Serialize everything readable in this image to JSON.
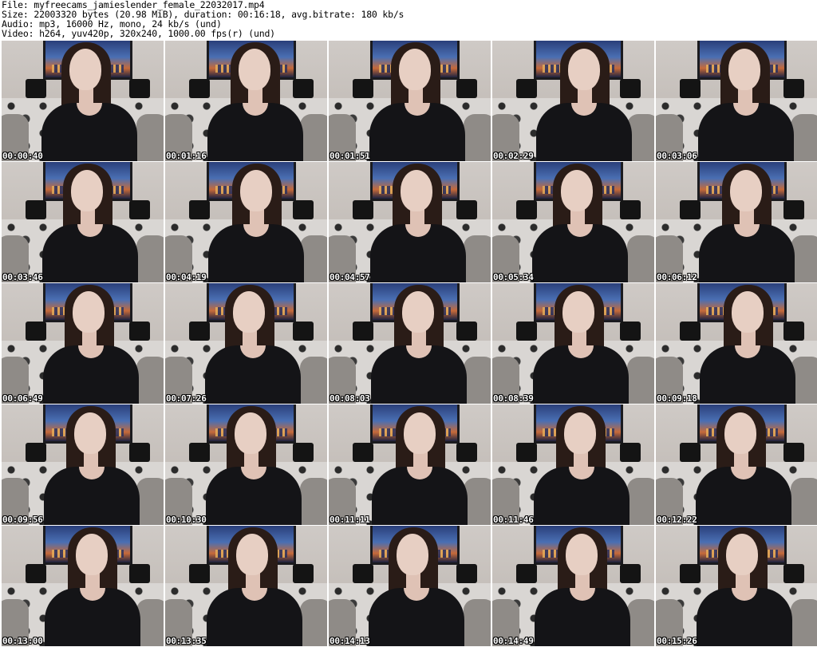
{
  "header": {
    "file_line": "File: myfreecams_jamieslender_female_22032017.mp4",
    "size_line": "Size: 22003320 bytes (20.98 MiB), duration: 00:16:18, avg.bitrate: 180 kb/s",
    "audio_line": "Audio: mp3, 16000 Hz, mono, 24 kb/s (und)",
    "video_line": "Video: h264, yuv420p, 320x240, 1000.00 fps(r) (und)"
  },
  "timestamps": [
    "00:00:40",
    "00:01:16",
    "00:01:51",
    "00:02:29",
    "00:03:06",
    "00:03:46",
    "00:04:19",
    "00:04:57",
    "00:05:34",
    "00:06:12",
    "00:06:49",
    "00:07:26",
    "00:08:03",
    "00:08:39",
    "00:09:18",
    "00:09:56",
    "00:10:30",
    "00:11:11",
    "00:11:46",
    "00:12:22",
    "00:13:00",
    "00:13:35",
    "00:14:13",
    "00:14:49",
    "00:15:26"
  ],
  "colors": {
    "background": "#ffffff",
    "text": "#000000",
    "timestamp_text": "#ffffff",
    "timestamp_outline": "#000000"
  }
}
